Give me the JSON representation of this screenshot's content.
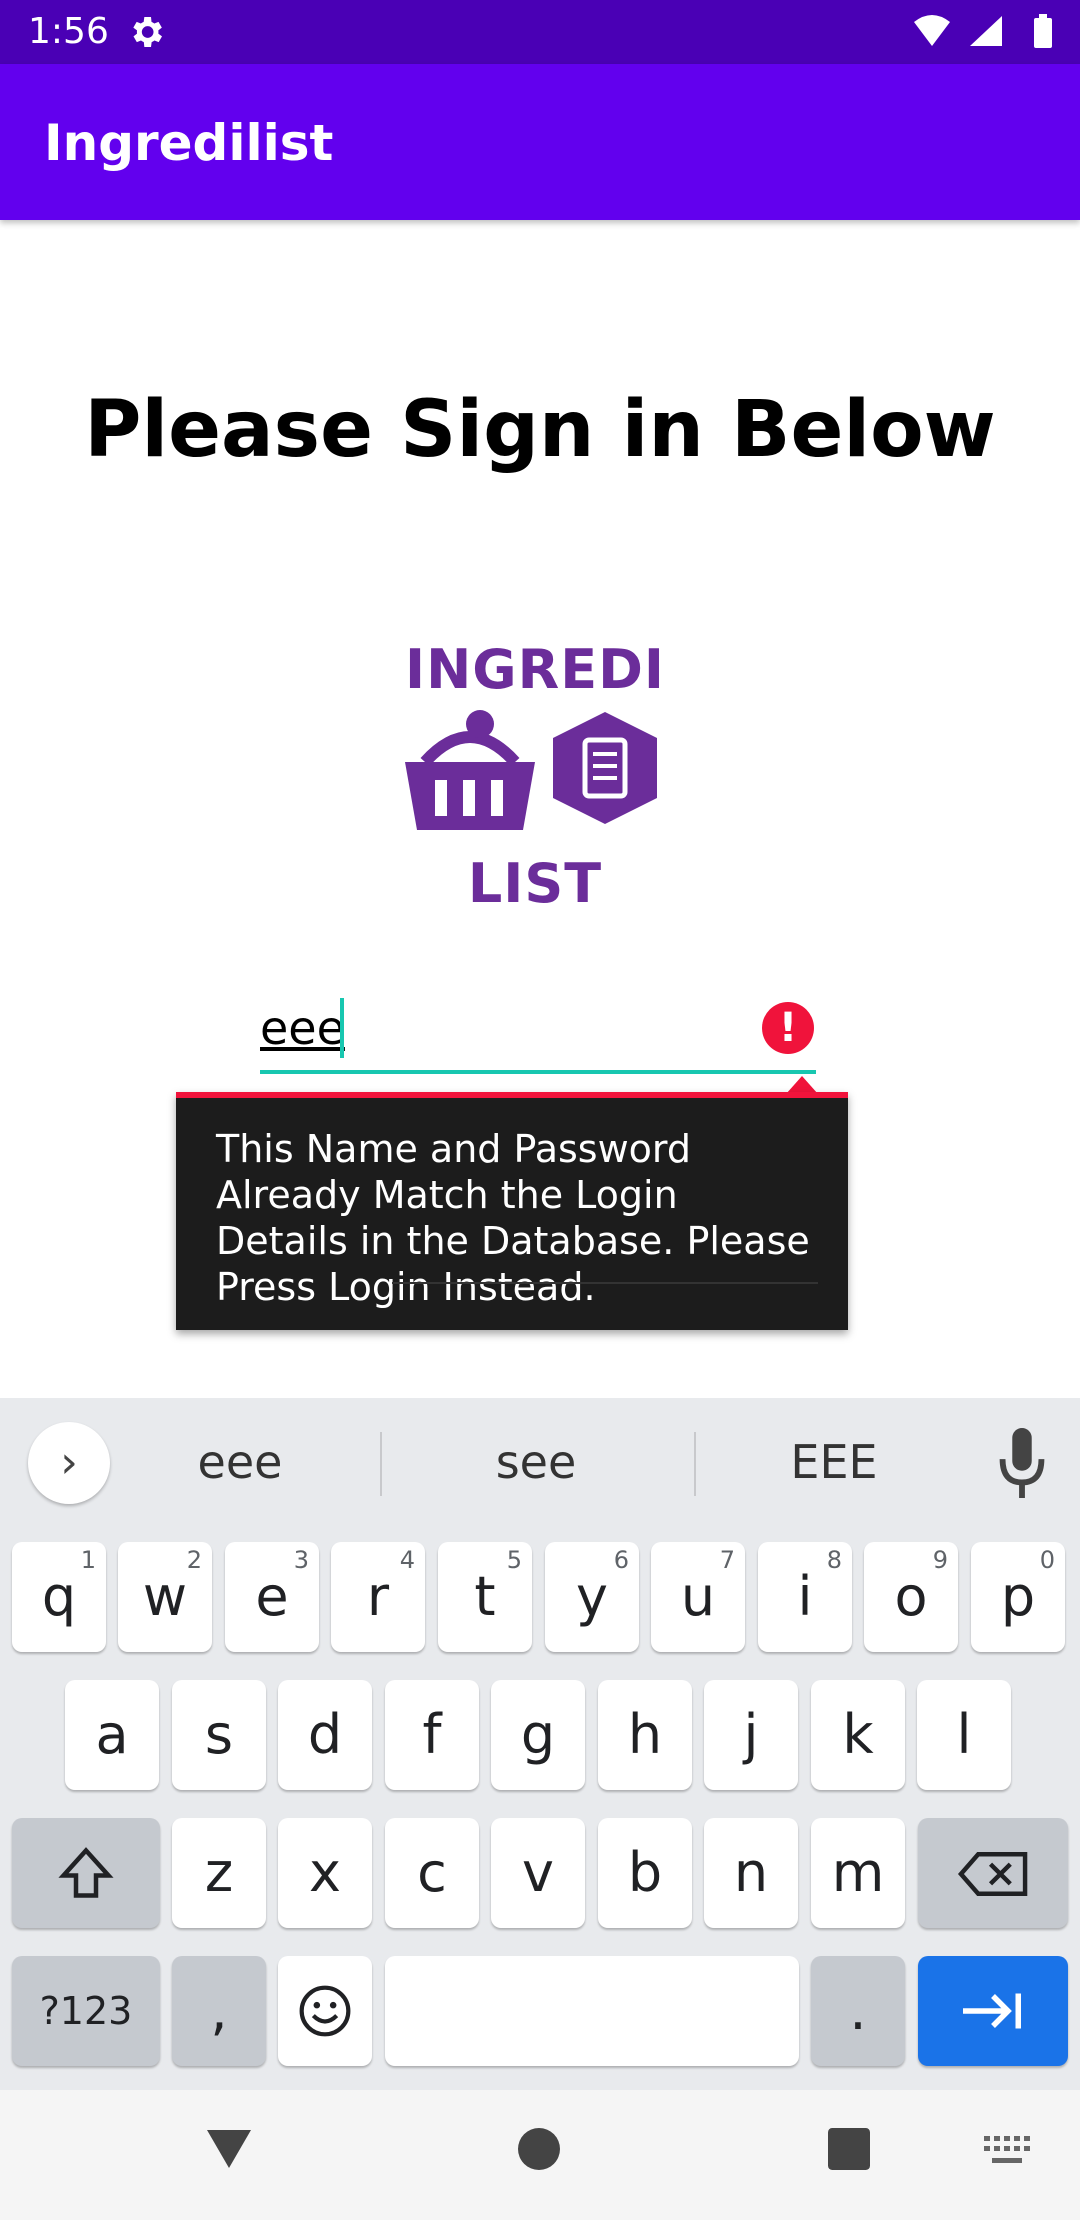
{
  "status_bar": {
    "time": "1:56",
    "settings_icon": "gear-icon",
    "wifi_icon": "wifi-icon",
    "signal_icon": "signal-icon",
    "battery_icon": "battery-icon"
  },
  "app_bar": {
    "title": "Ingredilist"
  },
  "main": {
    "heading": "Please Sign in Below",
    "logo": {
      "top_text": "INGREDI",
      "bottom_text": "LIST"
    },
    "name_input": {
      "value": "eee"
    },
    "error_popup": {
      "message": "This Name and Password Already Match the Login Details in the Database. Please Press Login Instead.",
      "icon": "error-icon"
    }
  },
  "keyboard": {
    "suggestions": [
      "eee",
      "see",
      "EEE"
    ],
    "row1": [
      {
        "key": "q",
        "sub": "1"
      },
      {
        "key": "w",
        "sub": "2"
      },
      {
        "key": "e",
        "sub": "3"
      },
      {
        "key": "r",
        "sub": "4"
      },
      {
        "key": "t",
        "sub": "5"
      },
      {
        "key": "y",
        "sub": "6"
      },
      {
        "key": "u",
        "sub": "7"
      },
      {
        "key": "i",
        "sub": "8"
      },
      {
        "key": "o",
        "sub": "9"
      },
      {
        "key": "p",
        "sub": "0"
      }
    ],
    "row2": [
      "a",
      "s",
      "d",
      "f",
      "g",
      "h",
      "j",
      "k",
      "l"
    ],
    "row3": [
      "z",
      "x",
      "c",
      "v",
      "b",
      "n",
      "m"
    ],
    "symbols_label": "?123",
    "comma_label": ",",
    "period_label": ".",
    "colors": {
      "background": "#e8eaed",
      "enter_key": "#1a73e8"
    }
  },
  "colors": {
    "app_bar": "#6200ee",
    "status_bar": "#4a00b5",
    "accent": "#18c7b0",
    "error": "#f0133b",
    "logo": "#6b2d9a"
  }
}
